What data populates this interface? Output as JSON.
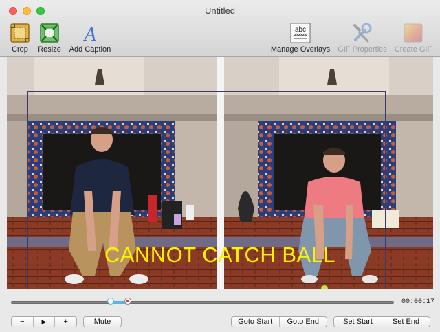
{
  "window": {
    "title": "Untitled"
  },
  "toolbar": {
    "crop": "Crop",
    "resize": "Resize",
    "add_caption": "Add Caption",
    "manage_overlays": "Manage Overlays",
    "gif_properties": "GIF Properties",
    "create_gif": "Create GIF",
    "overlay_icon_text": "abc"
  },
  "preview": {
    "caption": "CANNOT CATCH BALL"
  },
  "timeline": {
    "time": "00:00:17",
    "selection_start_fraction": 0.26,
    "selection_end_fraction": 0.305
  },
  "controls": {
    "zoom_out": "−",
    "play": "▶",
    "zoom_in": "+",
    "mute": "Mute",
    "goto_start": "Goto Start",
    "goto_end": "Goto End",
    "set_start": "Set Start",
    "set_end": "Set End"
  },
  "colors": {
    "caption": "#fff200",
    "selection": "#5ab3e6"
  }
}
